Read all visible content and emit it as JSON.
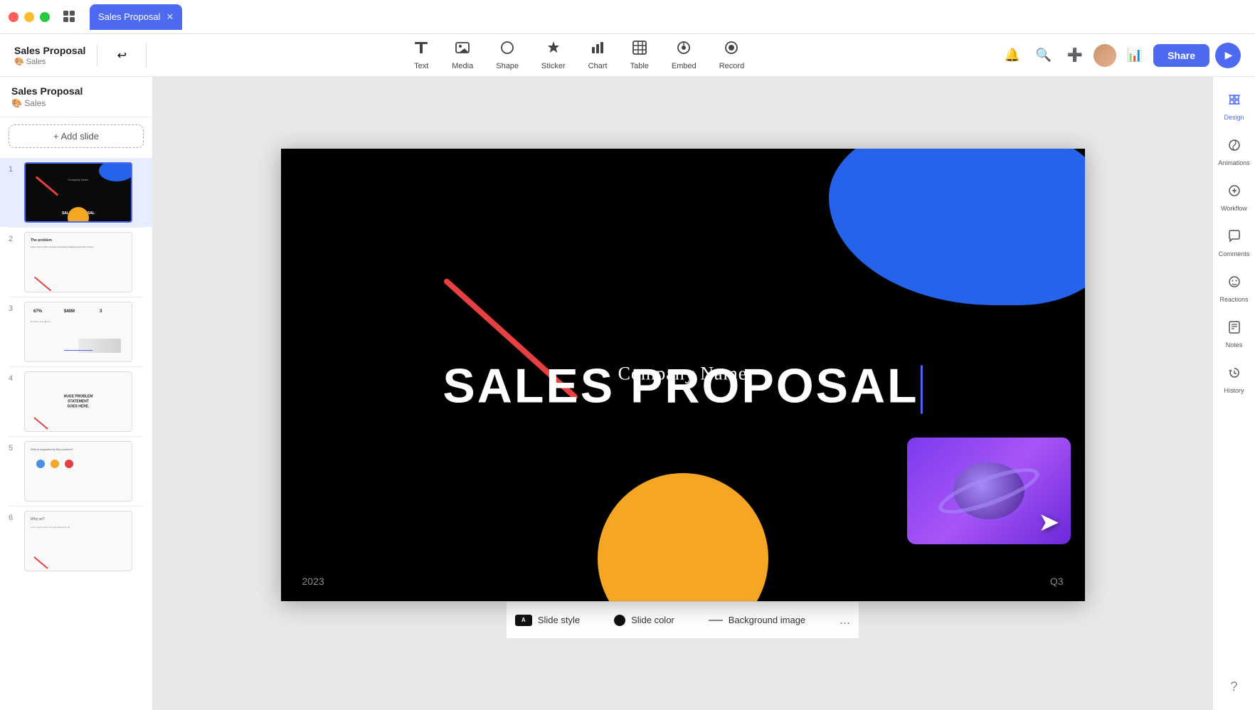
{
  "window": {
    "title": "Sales Proposal",
    "tab_label": "Sales Proposal"
  },
  "presentation": {
    "title": "Sales Proposal",
    "subtitle": "🎨 Sales"
  },
  "toolbar": {
    "tools": [
      {
        "id": "text",
        "label": "Text",
        "icon": "T"
      },
      {
        "id": "media",
        "label": "Media",
        "icon": "⊡"
      },
      {
        "id": "shape",
        "label": "Shape",
        "icon": "○"
      },
      {
        "id": "sticker",
        "label": "Sticker",
        "icon": "★"
      },
      {
        "id": "chart",
        "label": "Chart",
        "icon": "📊"
      },
      {
        "id": "table",
        "label": "Table",
        "icon": "⊞"
      },
      {
        "id": "embed",
        "label": "Embed",
        "icon": "⊙"
      },
      {
        "id": "record",
        "label": "Record",
        "icon": "⊚"
      }
    ],
    "share_label": "Share"
  },
  "slides": [
    {
      "number": "1",
      "active": true,
      "type": "title"
    },
    {
      "number": "2",
      "active": false,
      "type": "problem"
    },
    {
      "number": "3",
      "active": false,
      "type": "stats"
    },
    {
      "number": "4",
      "active": false,
      "type": "problem-statement"
    },
    {
      "number": "5",
      "active": false,
      "type": "who"
    },
    {
      "number": "6",
      "active": false,
      "type": "why"
    }
  ],
  "canvas": {
    "company_name": "Company Name",
    "title": "SALES PROPOSAL",
    "year": "2023",
    "quarter": "Q3"
  },
  "right_panel": {
    "tools": [
      {
        "id": "design",
        "label": "Design",
        "icon": "✂"
      },
      {
        "id": "animations",
        "label": "Animations",
        "icon": "◎"
      },
      {
        "id": "workflow",
        "label": "Workflow",
        "icon": "⊕"
      },
      {
        "id": "comments",
        "label": "Comments",
        "icon": "💬"
      },
      {
        "id": "reactions",
        "label": "Reactions",
        "icon": "😊"
      },
      {
        "id": "notes",
        "label": "Notes",
        "icon": "📝"
      },
      {
        "id": "history",
        "label": "History",
        "icon": "⟳"
      }
    ]
  },
  "bottom_bar": {
    "slide_style_label": "Slide style",
    "slide_color_label": "Slide color",
    "background_image_label": "Background image",
    "more_label": "..."
  },
  "add_slide_label": "+ Add slide"
}
